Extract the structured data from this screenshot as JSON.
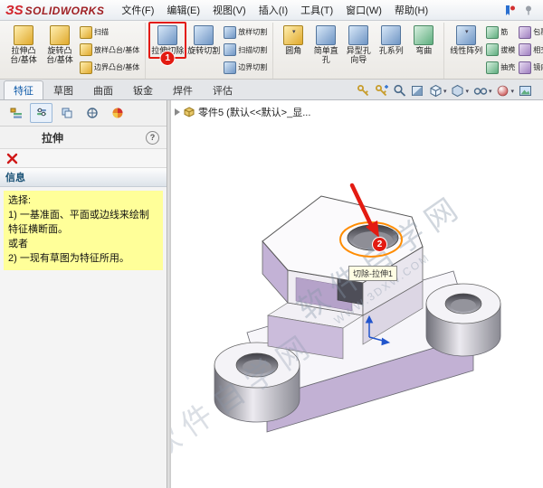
{
  "colors": {
    "accent_red": "#e31b12",
    "message_yellow": "#ffff99",
    "model_lavender": "#c2b1d4",
    "selection_orange": "#ff8c00",
    "logo_red": "#b31f24"
  },
  "menubar": {
    "logo_glyph": "ЗS",
    "logo_text": "SOLIDWORKS",
    "items": [
      {
        "label": "文件(F)"
      },
      {
        "label": "编辑(E)"
      },
      {
        "label": "视图(V)"
      },
      {
        "label": "插入(I)"
      },
      {
        "label": "工具(T)"
      },
      {
        "label": "窗口(W)"
      },
      {
        "label": "帮助(H)"
      }
    ]
  },
  "ribbon": {
    "badge": "1",
    "items": [
      {
        "label": "拉伸凸台/基体"
      },
      {
        "label": "旋转凸台/基体"
      },
      {
        "label": "扫描"
      },
      {
        "label": "放样凸台/基体"
      },
      {
        "label": "边界凸台/基体"
      },
      {
        "label": "拉伸切除"
      },
      {
        "label": "旋转切割"
      },
      {
        "label": "放样切割"
      },
      {
        "label": "扫描切割"
      },
      {
        "label": "边界切割"
      },
      {
        "label": "圆角"
      },
      {
        "label": "简单直孔"
      },
      {
        "label": "异型孔向导"
      },
      {
        "label": "孔系列"
      },
      {
        "label": "弯曲"
      },
      {
        "label": "线性阵列"
      },
      {
        "label": "筋"
      },
      {
        "label": "拔模"
      },
      {
        "label": "抽壳"
      },
      {
        "label": "包覆"
      },
      {
        "label": "相交"
      },
      {
        "label": "镜向"
      }
    ]
  },
  "tabs": {
    "items": [
      {
        "label": "特征"
      },
      {
        "label": "草图"
      },
      {
        "label": "曲面"
      },
      {
        "label": "钣金"
      },
      {
        "label": "焊件"
      },
      {
        "label": "评估"
      }
    ]
  },
  "hud_icons": [
    "key",
    "key-plus",
    "zoom-fit",
    "section-view",
    "view-orientation",
    "display-style",
    "hide-show-items",
    "edit-appearance",
    "apply-scene"
  ],
  "panel": {
    "title": "拉伸",
    "help_glyph": "?",
    "section_header": "信息",
    "message_lines": [
      "选择:",
      "1) 一基准面、平面或边线来绘制特征横断面。",
      "或者",
      "2) 一现有草图为特征所用。"
    ]
  },
  "graphics": {
    "tree_label": "零件5 (默认<<默认>_显...",
    "tooltip": "切除-拉伸1",
    "badge": "2",
    "watermark_text": "软件自学网",
    "watermark_url": "WWW.3DXW.COM"
  }
}
